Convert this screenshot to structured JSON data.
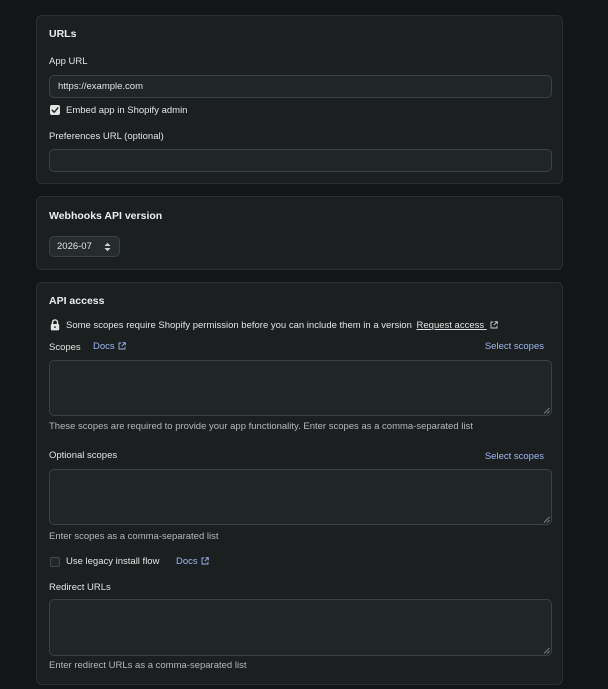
{
  "urls": {
    "heading": "URLs",
    "app_url_label": "App URL",
    "app_url_value": "https://example.com",
    "embed_label": "Embed app in Shopify admin",
    "embed_checked": true,
    "preferences_label": "Preferences URL (optional)",
    "preferences_value": ""
  },
  "webhooks": {
    "heading": "Webhooks API version",
    "version": "2026-07"
  },
  "api_access": {
    "heading": "API access",
    "notice": "Some scopes require Shopify permission before you can include them in a version",
    "request_access": "Request access",
    "scopes_label": "Scopes",
    "docs_link": "Docs",
    "select_scopes": "Select scopes",
    "scopes_help": "These scopes are required to provide your app functionality. Enter scopes as a comma-separated list",
    "optional_scopes_label": "Optional scopes",
    "optional_select_scopes": "Select scopes",
    "optional_help": "Enter scopes as a comma-separated list",
    "legacy_label": "Use legacy install flow",
    "legacy_docs": "Docs",
    "legacy_checked": false,
    "redirect_label": "Redirect URLs",
    "redirect_help": "Enter redirect URLs as a comma-separated list"
  },
  "colors": {
    "background": "#131617",
    "card": "#1b1f20",
    "input": "#202526",
    "link": "#9db7f2"
  }
}
